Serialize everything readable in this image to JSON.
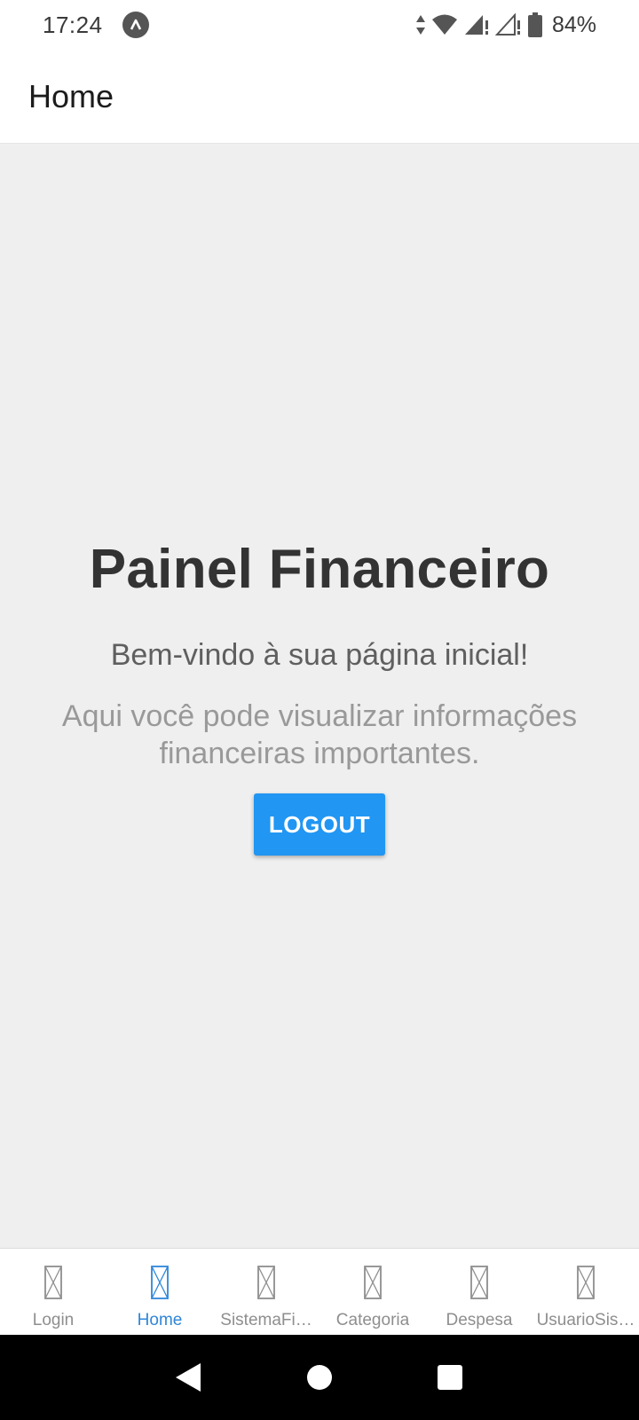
{
  "status_bar": {
    "time": "17:24",
    "battery": "84%",
    "icons": [
      "notification-a-icon",
      "data-arrows-icon",
      "wifi-icon",
      "signal-icon",
      "signal-2-icon",
      "battery-icon"
    ]
  },
  "app_bar": {
    "title": "Home"
  },
  "main": {
    "heading": "Painel Financeiro",
    "welcome": "Bem-vindo à sua página inicial!",
    "info": "Aqui você pode visualizar informações financeiras importantes.",
    "logout_label": "LOGOUT",
    "accent_color": "#2196f3"
  },
  "tabs": [
    {
      "label": "Login",
      "active": false
    },
    {
      "label": "Home",
      "active": true
    },
    {
      "label": "SistemaFi…",
      "active": false
    },
    {
      "label": "Categoria",
      "active": false
    },
    {
      "label": "Despesa",
      "active": false
    },
    {
      "label": "UsuarioSis…",
      "active": false
    }
  ],
  "nav_bar": {
    "icons": [
      "back-icon",
      "home-circle-icon",
      "recents-square-icon"
    ]
  }
}
